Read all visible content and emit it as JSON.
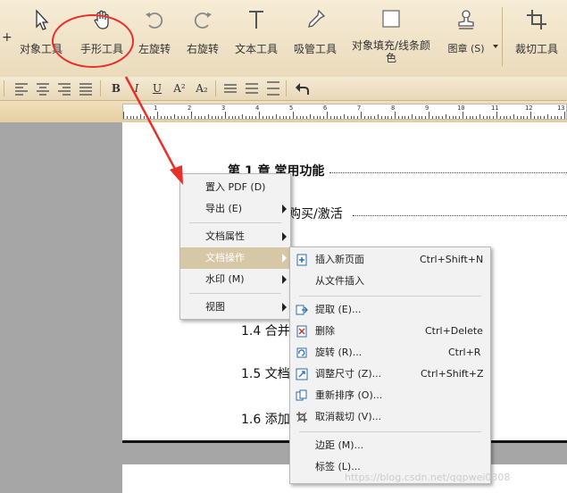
{
  "toolbar": {
    "partial_tool_label": "对象工具",
    "tools": [
      {
        "label": "对象工具",
        "icon": "arrow-cursor-icon"
      },
      {
        "label": "手形工具",
        "icon": "hand-icon"
      },
      {
        "label": "左旋转",
        "icon": "rotate-left-icon"
      },
      {
        "label": "右旋转",
        "icon": "rotate-right-icon"
      },
      {
        "label": "文本工具",
        "icon": "text-t-icon"
      },
      {
        "label": "吸管工具",
        "icon": "eyedropper-icon"
      },
      {
        "label": "对象填充/线条颜色",
        "line1": "对象填充/线条颜",
        "line2": "色",
        "icon": "fill-square-icon"
      },
      {
        "label": "图章 (S)",
        "icon": "stamp-icon"
      },
      {
        "label": "裁切工具",
        "icon": "crop-icon"
      }
    ]
  },
  "format_bar": {
    "bold": "B",
    "italic": "I",
    "underline": "U",
    "superscript": "A²",
    "subscript": "A₂"
  },
  "ruler": {
    "numbers": [
      "1",
      "2",
      "3",
      "4",
      "5",
      "6",
      "7",
      "8",
      "9",
      "10",
      "11",
      "12",
      "13"
    ]
  },
  "document": {
    "toc": [
      {
        "text": "第 1 章  常用功能",
        "bold": true
      },
      {
        "text": "购买/激活"
      },
      {
        "text": "1.4 合并"
      },
      {
        "text": "1.5 文档"
      },
      {
        "text": "1.6 添加"
      }
    ]
  },
  "context_menu": {
    "items": [
      {
        "label": "置入 PDF (D)",
        "submenu": false
      },
      {
        "label": "导出 (E)",
        "submenu": true
      },
      {
        "label": "文档属性",
        "submenu": true
      },
      {
        "label": "文档操作",
        "submenu": true,
        "highlighted": true
      },
      {
        "label": "水印 (M)",
        "submenu": true
      },
      {
        "label": "视图",
        "submenu": true
      }
    ]
  },
  "submenu": {
    "items": [
      {
        "label": "插入新页面",
        "shortcut": "Ctrl+Shift+N",
        "icon": "insert-page-icon"
      },
      {
        "label": "从文件插入",
        "shortcut": "",
        "icon": ""
      },
      {
        "label": "提取 (E)...",
        "shortcut": "",
        "icon": "extract-icon"
      },
      {
        "label": "删除",
        "shortcut": "Ctrl+Delete",
        "icon": "delete-page-icon"
      },
      {
        "label": "旋转 (R)...",
        "shortcut": "Ctrl+R",
        "icon": "rotate-page-icon"
      },
      {
        "label": "调整尺寸 (Z)...",
        "shortcut": "Ctrl+Shift+Z",
        "icon": "resize-icon"
      },
      {
        "label": "重新排序 (O)...",
        "shortcut": "",
        "icon": "reorder-icon"
      },
      {
        "label": "取消裁切 (V)...",
        "shortcut": "",
        "icon": "uncrop-icon"
      },
      {
        "label": "边距 (M)...",
        "shortcut": "",
        "icon": ""
      },
      {
        "label": "标签 (L)...",
        "shortcut": "",
        "icon": ""
      }
    ]
  },
  "watermark": "https://blog.csdn.net/qqpwei0308",
  "colors": {
    "annotation": "#e8302a",
    "highlight": "#d6c7a6"
  }
}
